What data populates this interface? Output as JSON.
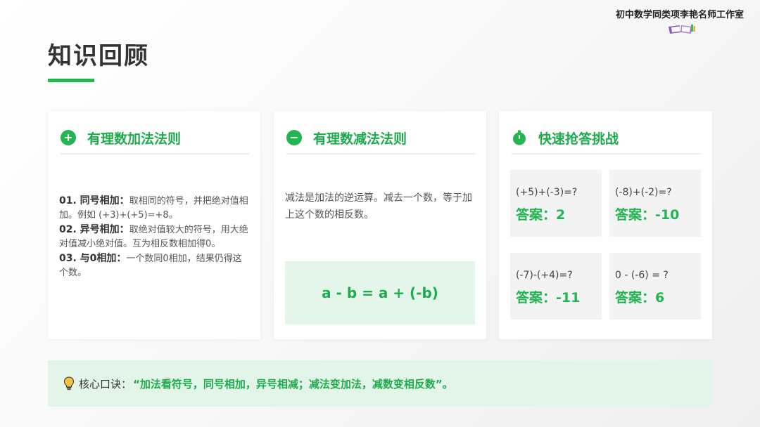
{
  "header": {
    "brand_text": "初中数学同类项李艳名师工作室",
    "title": "知识回顾"
  },
  "cards": {
    "addition": {
      "icon": "plus-circle-icon",
      "title": "有理数加法法则",
      "rules": [
        {
          "label": "01. 同号相加：",
          "text": "取相同的符号，并把绝对值相加。例如 (+3)+(+5)=+8。"
        },
        {
          "label": "02. 异号相加：",
          "text": "取绝对值较大的符号，用大绝对值减小绝对值。互为相反数相加得0。"
        },
        {
          "label": "03. 与0相加：",
          "text": "一个数同0相加，结果仍得这个数。"
        }
      ]
    },
    "subtraction": {
      "icon": "minus-circle-icon",
      "title": "有理数减法法则",
      "description": "减法是加法的逆运算。减去一个数，等于加上这个数的相反数。",
      "formula": "a - b = a + (-b)"
    },
    "quiz": {
      "icon": "stopwatch-icon",
      "title": "快速抢答挑战",
      "items": [
        {
          "question": "(+5)+(-3)=?",
          "answer": "答案：2"
        },
        {
          "question": "(-8)+(-2)=?",
          "answer": "答案：-10"
        },
        {
          "question": "(-7)-(+4)=?",
          "answer": "答案：-11"
        },
        {
          "question": "0 - (-6) = ?",
          "answer": "答案：6"
        }
      ]
    }
  },
  "tip": {
    "icon": "lightbulb-icon",
    "label": "核心口诀：",
    "text": "“加法看符号，同号相加，异号相减；减法变加法，减数变相反数”。"
  },
  "colors": {
    "accent": "#1faa4c",
    "accent_light": "#e3f5e8",
    "card_bg": "#ffffff",
    "quiz_bg": "#f3f3f3"
  }
}
